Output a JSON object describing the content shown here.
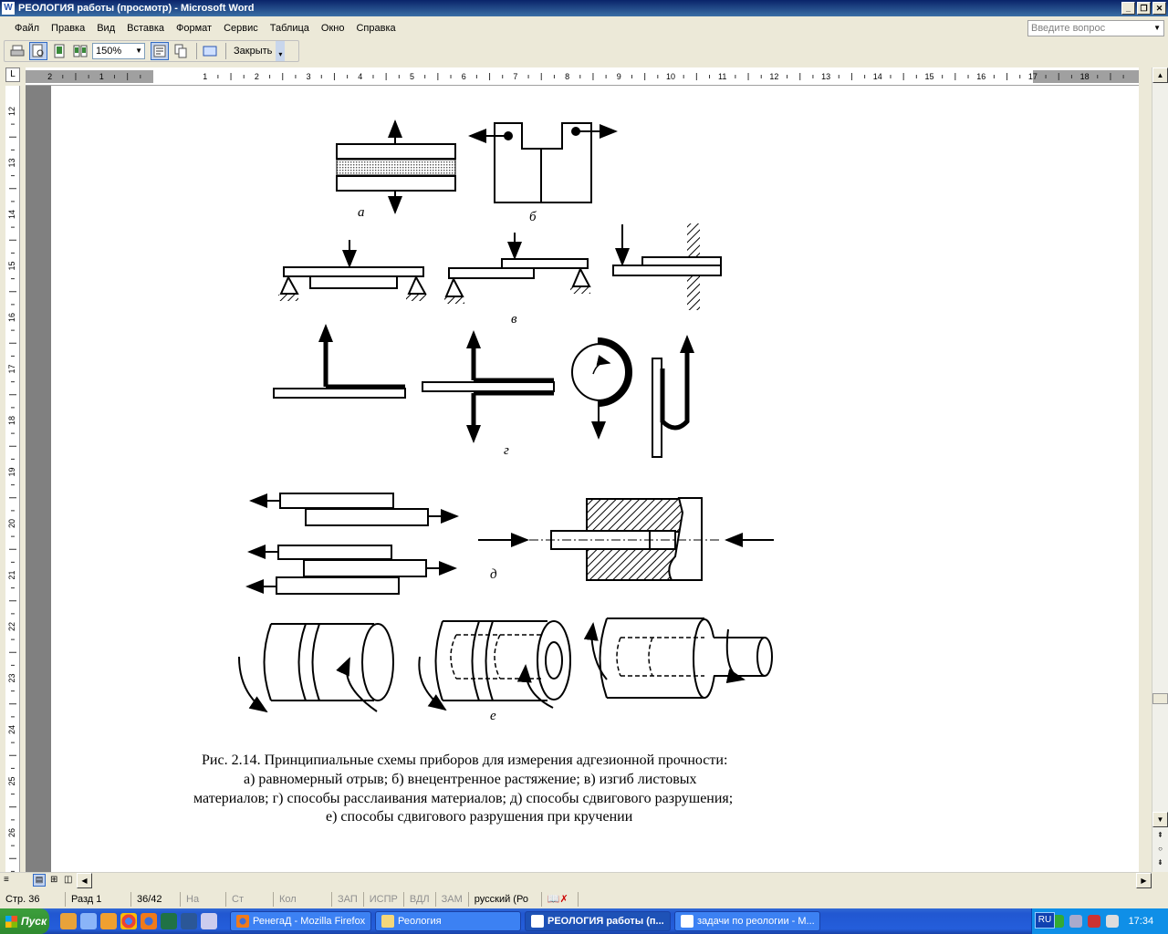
{
  "window": {
    "title": "РЕОЛОГИЯ работы (просмотр) - Microsoft Word",
    "icon_label": "W"
  },
  "menu": [
    "Файл",
    "Правка",
    "Вид",
    "Вставка",
    "Формат",
    "Сервис",
    "Таблица",
    "Окно",
    "Справка"
  ],
  "ask_placeholder": "Введите вопрос",
  "toolbar": {
    "zoom": "150%",
    "close_label": "Закрыть"
  },
  "ruler": {
    "h_ticks": [
      "2",
      "1",
      "1",
      "2",
      "3",
      "4",
      "5",
      "6",
      "7",
      "8",
      "9",
      "10",
      "11",
      "12",
      "13",
      "14",
      "15",
      "16",
      "17",
      "18"
    ],
    "v_ticks": [
      "12",
      "13",
      "14",
      "15",
      "16",
      "17",
      "18",
      "19",
      "20",
      "21",
      "22",
      "23",
      "24",
      "25",
      "26"
    ]
  },
  "figure": {
    "labels": {
      "a": "а",
      "b": "б",
      "v": "в",
      "g": "г",
      "d": "д",
      "e": "е"
    },
    "caption": [
      "Рис. 2.14. Принципиальные схемы приборов для измерения адгезионной прочности:",
      "а) равномерный отрыв; б) внецентренное растяжение; в) изгиб листовых",
      "материалов; г) способы расслаивания материалов; д) способы сдвигового разрушения;",
      "е) способы сдвигового разрушения при кручении"
    ]
  },
  "status": {
    "page": "Стр. 36",
    "section": "Разд 1",
    "count": "36/42",
    "at": "На",
    "line": "Ст",
    "col": "Кол",
    "rec": "ЗАП",
    "trk": "ИСПР",
    "ext": "ВДЛ",
    "ovr": "ЗАМ",
    "lang": "русский (Ро"
  },
  "taskbar": {
    "start": "Пуск",
    "tasks": [
      "РенегаД - Mozilla Firefox",
      "Реология",
      "РЕОЛОГИЯ работы (п...",
      "задачи по реологии - М..."
    ],
    "lang": "RU",
    "clock": "17:34"
  }
}
